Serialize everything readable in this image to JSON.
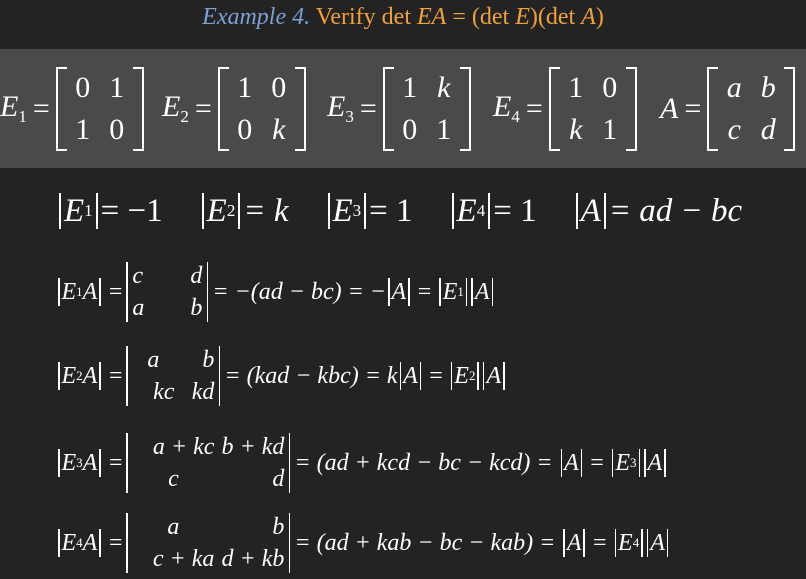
{
  "title": {
    "example": "Example 4.",
    "verify": " Verify det ",
    "ea": "EA",
    "eq": " = (det ",
    "e": "E",
    "mid": ")(det ",
    "a": "A",
    "close": ")"
  },
  "matrices": [
    {
      "name": "E",
      "sub": "1",
      "cells": [
        "0",
        "1",
        "1",
        "0"
      ]
    },
    {
      "name": "E",
      "sub": "2",
      "cells": [
        "1",
        "0",
        "0",
        "k"
      ]
    },
    {
      "name": "E",
      "sub": "3",
      "cells": [
        "1",
        "k",
        "0",
        "1"
      ]
    },
    {
      "name": "E",
      "sub": "4",
      "cells": [
        "1",
        "0",
        "k",
        "1"
      ]
    },
    {
      "name": "A",
      "sub": "",
      "cells": [
        "a",
        "b",
        "c",
        "d"
      ]
    }
  ],
  "determinants": {
    "e1": "= −1",
    "e2": "= k",
    "e3": "= 1",
    "e4": "= 1",
    "a": "= ad − bc"
  },
  "rows": [
    {
      "cells": [
        "c",
        "d",
        "a",
        "b"
      ],
      "rhs": "= −(ad − bc) = −"
    },
    {
      "cells": [
        "a",
        "b",
        "kc",
        "kd"
      ],
      "rhs": "= (kad − kbc) = k"
    },
    {
      "cells": [
        "a + kc",
        "b + kd",
        "c",
        "d"
      ],
      "rhs": "= (ad + kcd − bc − kcd) ="
    },
    {
      "cells": [
        "a",
        "b",
        "c + ka",
        "d + kb"
      ],
      "rhs": "= (ad + kab − bc − kab) ="
    }
  ],
  "symbols": {
    "E": "E",
    "A": "A",
    "equals": "=",
    "subs": [
      "1",
      "2",
      "3",
      "4"
    ]
  }
}
